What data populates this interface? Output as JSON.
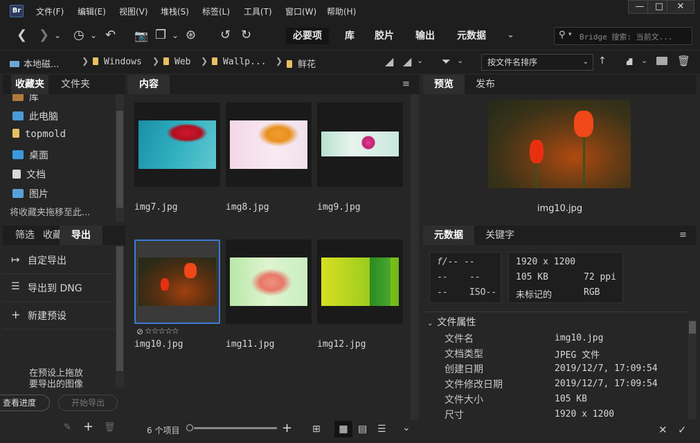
{
  "menubar": {
    "logo": "Br",
    "items": [
      "文件(F)",
      "编辑(E)",
      "视图(V)",
      "堆栈(S)",
      "标签(L)",
      "工具(T)",
      "窗口(W)",
      "帮助(H)"
    ],
    "min": "—",
    "max": "□",
    "close": "✕"
  },
  "toolbar": {
    "workspaces": [
      "必要项",
      "库",
      "胶片",
      "输出",
      "元数据"
    ],
    "search_placeholder": "Bridge 搜索: 当前文..."
  },
  "path": {
    "items": [
      "本地磁...",
      "Windows",
      "Web",
      "Wallp...",
      "鲜花"
    ],
    "sort": "按文件名排序"
  },
  "left": {
    "tabs": [
      "收藏夹",
      "文件夹"
    ],
    "favorites": [
      {
        "label": "库",
        "icon": "library-icon",
        "color": "#b07a3a"
      },
      {
        "label": "此电脑",
        "icon": "computer-icon",
        "color": "#4a9ad6"
      },
      {
        "label": "topmold",
        "icon": "folder-icon",
        "color": "#e8c060"
      },
      {
        "label": "桌面",
        "icon": "desktop-icon",
        "color": "#3a9ae0"
      },
      {
        "label": "文档",
        "icon": "document-icon",
        "color": "#d8d8d8"
      },
      {
        "label": "图片",
        "icon": "pictures-icon",
        "color": "#5aa0d8"
      }
    ],
    "drag_hint": "将收藏夹拖移至此...",
    "tabs2": [
      "筛选",
      "收藏",
      "导出"
    ],
    "export_items": [
      "自定导出",
      "导出到 DNG",
      "新建预设"
    ],
    "export_hint1": "在预设上拖放",
    "export_hint2": "要导出的图像",
    "progress_btn": "查看进度",
    "start_btn": "开始导出"
  },
  "content": {
    "tab": "内容",
    "files": [
      "img7.jpg",
      "img8.jpg",
      "img9.jpg",
      "img10.jpg",
      "img11.jpg",
      "img12.jpg"
    ],
    "count": "6 个项目",
    "stars": "☆☆☆☆☆",
    "reject": "⊘"
  },
  "right": {
    "tabs": [
      "预览",
      "发布"
    ],
    "preview_name": "img10.jpg",
    "meta_tabs": [
      "元数据",
      "关键字"
    ],
    "camera": {
      "fstop": "f/-- --",
      "r2": "--    --",
      "r3": "--    ISO--"
    },
    "info": {
      "dims": "1920 x 1200",
      "size": "105 KB",
      "ppi": "72 ppi",
      "tag": "未标记的",
      "mode": "RGB"
    },
    "section": "文件属性",
    "properties": [
      {
        "label": "文件名",
        "value": "img10.jpg"
      },
      {
        "label": "文档类型",
        "value": "JPEG 文件"
      },
      {
        "label": "创建日期",
        "value": "2019/12/7, 17:09:54"
      },
      {
        "label": "文件修改日期",
        "value": "2019/12/7, 17:09:54"
      },
      {
        "label": "文件大小",
        "value": "105 KB"
      },
      {
        "label": "尺寸",
        "value": "1920 x 1200"
      }
    ]
  }
}
